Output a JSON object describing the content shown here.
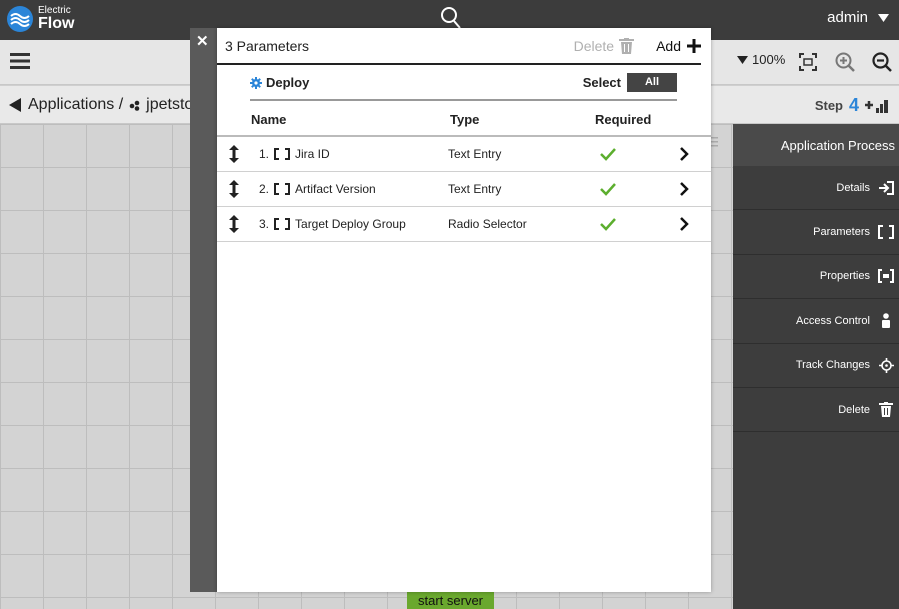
{
  "app": {
    "logo_small": "Electric",
    "logo_big": "Flow",
    "user": "admin"
  },
  "toolbar": {
    "zoom": "100%"
  },
  "breadcrumb": {
    "root": "Applications /",
    "current": "jpetsto"
  },
  "step": {
    "label": "Step",
    "number": "4"
  },
  "canvas": {
    "node_label": "start server"
  },
  "rightpanel": {
    "title": "Application Process",
    "items": [
      {
        "label": "Details",
        "icon": "arrow-into-box-icon"
      },
      {
        "label": "Parameters",
        "icon": "brackets-icon"
      },
      {
        "label": "Properties",
        "icon": "properties-icon"
      },
      {
        "label": "Access Control",
        "icon": "user-icon"
      },
      {
        "label": "Track Changes",
        "icon": "crosshair-icon"
      },
      {
        "label": "Delete",
        "icon": "trash-icon"
      }
    ]
  },
  "modal": {
    "count_label": "3 Parameters",
    "delete_label": "Delete",
    "add_label": "Add",
    "process_name": "Deploy",
    "select_label": "Select",
    "all_label": "All",
    "columns": {
      "name": "Name",
      "type": "Type",
      "required": "Required"
    },
    "rows": [
      {
        "index": "1.",
        "name": "Jira ID",
        "type": "Text Entry",
        "required": true
      },
      {
        "index": "2.",
        "name": "Artifact Version",
        "type": "Text Entry",
        "required": true
      },
      {
        "index": "3.",
        "name": "Target Deploy Group",
        "type": "Radio Selector",
        "required": true
      }
    ]
  },
  "colors": {
    "accent_blue": "#2b85d8",
    "check_green": "#5cae2e",
    "topbar": "#3c3c3c",
    "node_green": "#6aa82e"
  }
}
